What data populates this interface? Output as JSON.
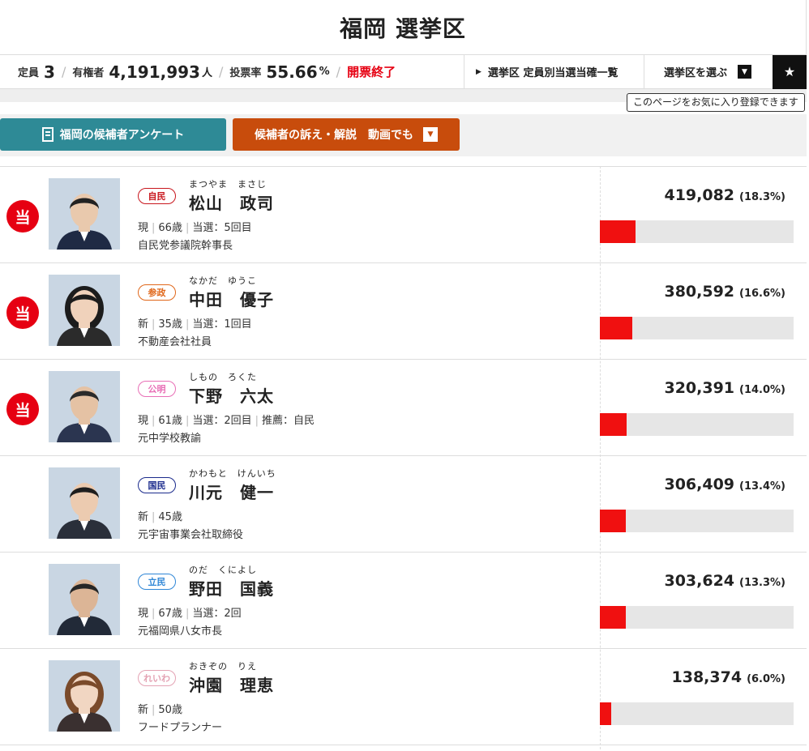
{
  "header": {
    "title": "福岡 選挙区"
  },
  "info": {
    "seats_label": "定員",
    "seats_value": "3",
    "electors_label": "有権者",
    "electors_value": "4,191,993",
    "electors_unit": "人",
    "turnout_label": "投票率",
    "turnout_value": "55.66",
    "turnout_unit": "%",
    "status": "開票終了",
    "winners_list_link": "選挙区 定員別当選当確一覧",
    "select_district": "選挙区を選ぶ",
    "favorite_tooltip": "このページをお気に入り登録できます"
  },
  "buttons": {
    "survey": "福岡の候補者アンケート",
    "video": "候補者の訴え・解説　動画でも"
  },
  "colors": {
    "accent_red": "#e60012",
    "survey_teal": "#2e8a96",
    "video_orange": "#c84c0c",
    "bar_red": "#f01010"
  },
  "candidates": [
    {
      "elected": true,
      "elected_mark": "当",
      "party": "自民",
      "party_color": "#c8161d",
      "kana": "まつやま　まさじ",
      "name": "松山　政司",
      "meta": [
        "現",
        "66歳",
        "当選：5回目"
      ],
      "career": "自民党参議院幹事長",
      "votes": "419,082",
      "pct_label": "(18.3%)",
      "pct": 18.3
    },
    {
      "elected": true,
      "elected_mark": "当",
      "party": "参政",
      "party_color": "#e0671a",
      "kana": "なかだ　ゆうこ",
      "name": "中田　優子",
      "meta": [
        "新",
        "35歳",
        "当選：1回目"
      ],
      "career": "不動産会社社員",
      "votes": "380,592",
      "pct_label": "(16.6%)",
      "pct": 16.6
    },
    {
      "elected": true,
      "elected_mark": "当",
      "party": "公明",
      "party_color": "#e86fb6",
      "kana": "しもの　ろくた",
      "name": "下野　六太",
      "meta": [
        "現",
        "61歳",
        "当選：2回目",
        "推薦：自民"
      ],
      "career": "元中学校教諭",
      "votes": "320,391",
      "pct_label": "(14.0%)",
      "pct": 14.0
    },
    {
      "elected": false,
      "elected_mark": "",
      "party": "国民",
      "party_color": "#1a2a8c",
      "kana": "かわもと　けんいち",
      "name": "川元　健一",
      "meta": [
        "新",
        "45歳"
      ],
      "career": "元宇宙事業会社取締役",
      "votes": "306,409",
      "pct_label": "(13.4%)",
      "pct": 13.4
    },
    {
      "elected": false,
      "elected_mark": "",
      "party": "立民",
      "party_color": "#2f86d6",
      "kana": "のだ　くによし",
      "name": "野田　国義",
      "meta": [
        "現",
        "67歳",
        "当選：2回"
      ],
      "career": "元福岡県八女市長",
      "votes": "303,624",
      "pct_label": "(13.3%)",
      "pct": 13.3
    },
    {
      "elected": false,
      "elected_mark": "",
      "party": "れいわ",
      "party_color": "#e4a3b4",
      "kana": "おきぞの　りえ",
      "name": "沖園　理恵",
      "meta": [
        "新",
        "50歳"
      ],
      "career": "フードプランナー",
      "votes": "138,374",
      "pct_label": "(6.0%)",
      "pct": 6.0
    }
  ]
}
